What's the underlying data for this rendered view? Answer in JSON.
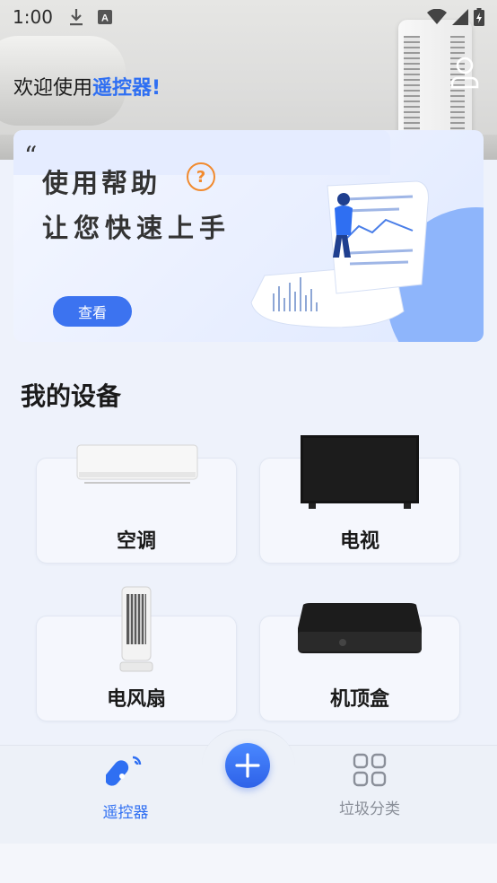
{
  "status_bar": {
    "time": "1:00",
    "icons": [
      "download-icon",
      "text-a-icon",
      "wifi-icon",
      "signal-icon",
      "battery-charging-icon"
    ]
  },
  "header": {
    "welcome_prefix": "欢迎使用",
    "welcome_highlight": "遥控器!",
    "avatar_icon": "user-icon"
  },
  "banner": {
    "quote_mark": "“",
    "title": "使用帮助",
    "help_glyph": "?",
    "subtitle": "让您快速上手",
    "button_label": "查看",
    "accent_color": "#3c73f0"
  },
  "devices_section": {
    "title": "我的设备",
    "items": [
      {
        "label": "空调",
        "icon": "air-conditioner-icon"
      },
      {
        "label": "电视",
        "icon": "tv-icon"
      },
      {
        "label": "电风扇",
        "icon": "fan-icon"
      },
      {
        "label": "机顶盒",
        "icon": "set-top-box-icon"
      }
    ]
  },
  "tabbar": {
    "tabs": [
      {
        "label": "遥控器",
        "icon": "remote-icon",
        "active": true,
        "color": "#2f6ff2"
      },
      {
        "label": "垃圾分类",
        "icon": "grid-icon",
        "active": false,
        "color": "#8a8f99"
      }
    ],
    "fab_icon": "plus-icon"
  }
}
